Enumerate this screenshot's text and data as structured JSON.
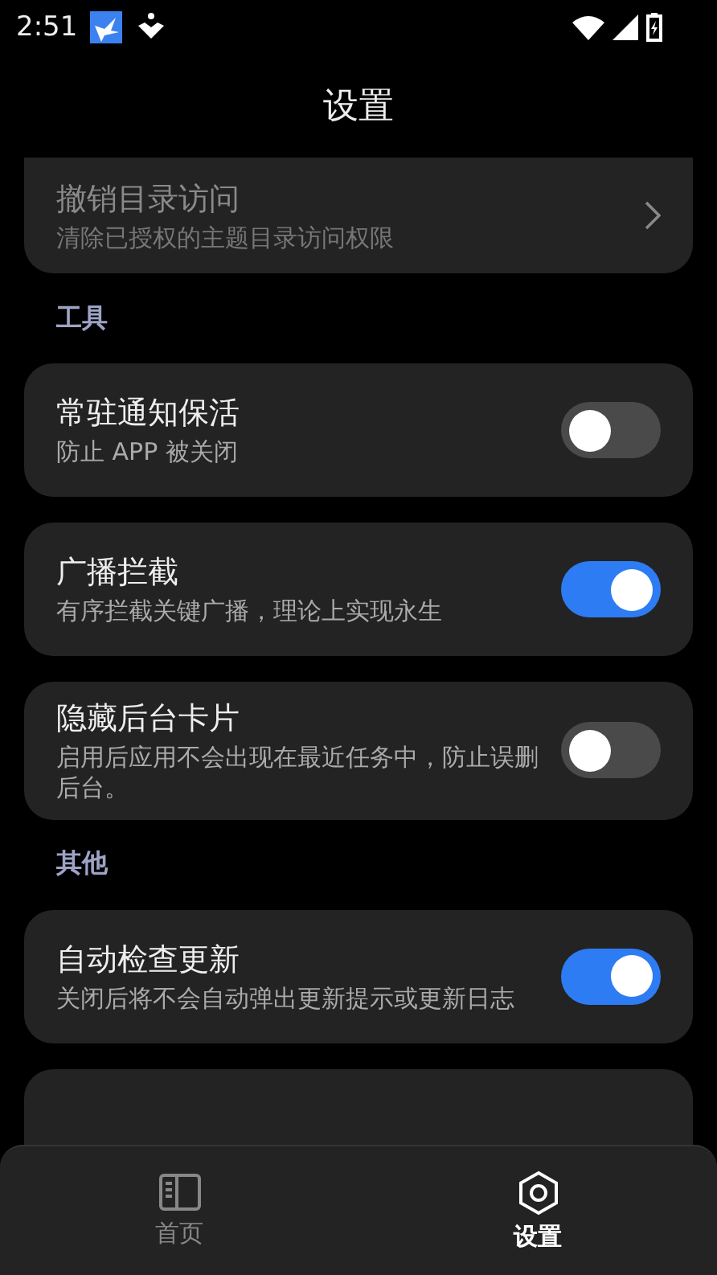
{
  "status_bar": {
    "time": "2:51"
  },
  "header": {
    "title": "设置"
  },
  "sections": [
    {
      "items": [
        {
          "kind": "link",
          "title": "撤销目录访问",
          "subtitle": "清除已授权的主题目录访问权限",
          "disabled": true
        }
      ]
    },
    {
      "label": "工具",
      "items": [
        {
          "kind": "switch",
          "title": "常驻通知保活",
          "subtitle": "防止 APP 被关闭",
          "on": false
        },
        {
          "kind": "switch",
          "title": "广播拦截",
          "subtitle": "有序拦截关键广播，理论上实现永生",
          "on": true
        },
        {
          "kind": "switch",
          "title": "隐藏后台卡片",
          "subtitle": "启用后应用不会出现在最近任务中，防止误删后台。",
          "on": false
        }
      ]
    },
    {
      "label": "其他",
      "items": [
        {
          "kind": "switch",
          "title": "自动检查更新",
          "subtitle": "关闭后将不会自动弹出更新提示或更新日志",
          "on": true
        },
        {
          "kind": "card"
        }
      ]
    }
  ],
  "nav": [
    {
      "kind": "home",
      "label": "首页",
      "selected": false
    },
    {
      "kind": "settings",
      "label": "设置",
      "selected": true
    }
  ]
}
